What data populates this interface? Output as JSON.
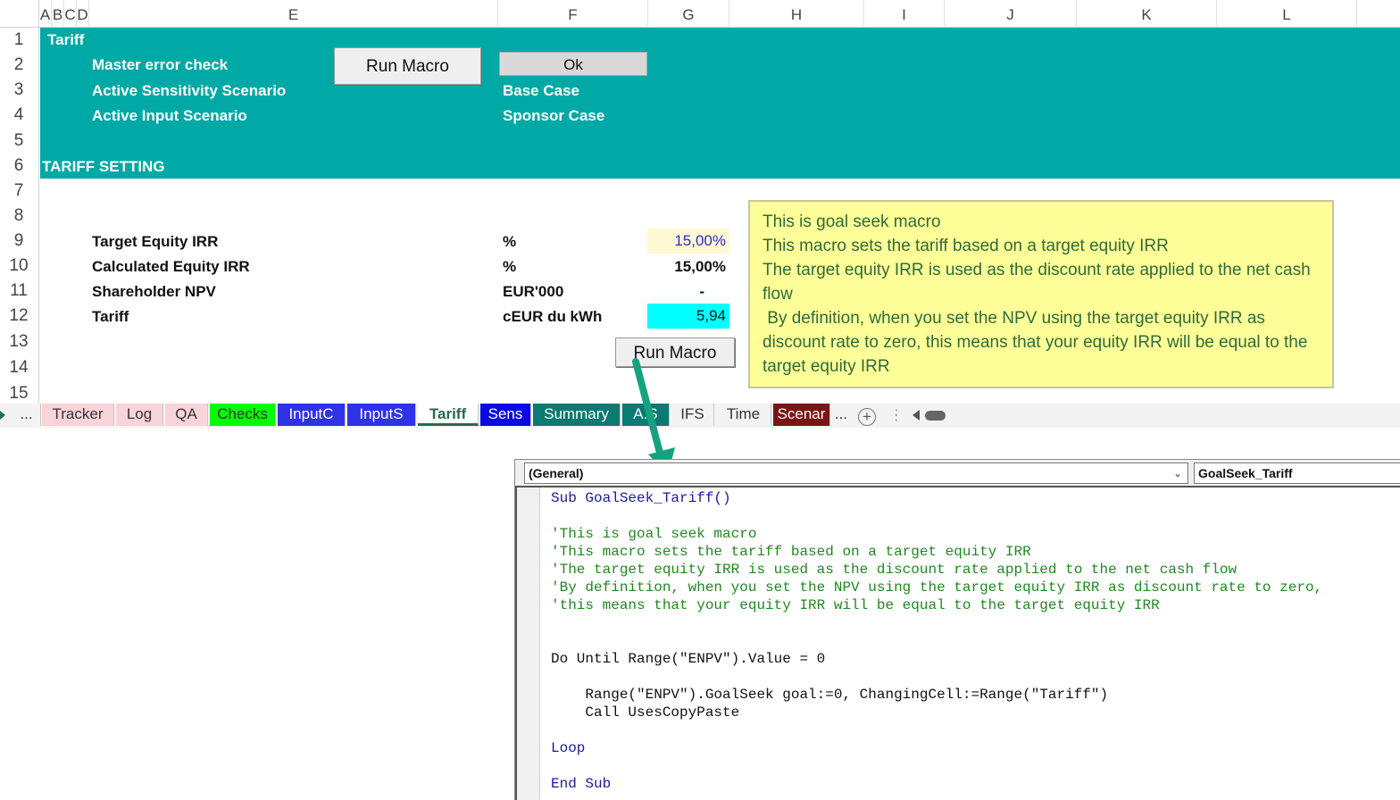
{
  "columns": [
    "A",
    "B",
    "C",
    "D",
    "E",
    "F",
    "G",
    "H",
    "I",
    "J",
    "K",
    "L"
  ],
  "rows": [
    "1",
    "2",
    "3",
    "4",
    "5",
    "6",
    "7",
    "8",
    "9",
    "10",
    "11",
    "12",
    "13",
    "14",
    "15"
  ],
  "sheet": {
    "title": "Tariff",
    "master_error_label": "Master error check",
    "sensitivity_label": "Active Sensitivity Scenario",
    "input_scenario_label": "Active Input Scenario",
    "run_macro_1": "Run Macro",
    "ok_value": "Ok",
    "sensitivity_value": "Base Case",
    "input_scenario_value": "Sponsor Case",
    "section_title": "TARIFF SETTING",
    "target_irr_label": "Target Equity IRR",
    "calc_irr_label": "Calculated Equity IRR",
    "npv_label": "Shareholder NPV",
    "tariff_label": "Tariff",
    "unit_pct_1": "%",
    "unit_pct_2": "%",
    "unit_eur": "EUR'000",
    "unit_tariff": "cEUR du kWh",
    "target_irr_value": "15,00%",
    "calc_irr_value": "15,00%",
    "npv_value": "-",
    "tariff_value": "5,94",
    "run_macro_2": "Run Macro"
  },
  "note": [
    "This is goal seek macro",
    "This macro sets the tariff based on a target equity IRR",
    "The target equity IRR is used as the discount rate applied to the net cash flow",
    " By definition, when you set the NPV using the target equity IRR as discount rate to zero, this means that your equity IRR will be equal to the target equity IRR"
  ],
  "tabs": {
    "more_left": "...",
    "items": [
      "Tracker",
      "Log",
      "QA",
      "Checks",
      "InputC",
      "InputS",
      "Tariff",
      "Sens",
      "Summary",
      "A.S",
      "IFS",
      "Time",
      "Scenar"
    ],
    "more_right": "...",
    "active": "Tariff",
    "colors": {
      "Tracker": "#f8d3d8",
      "Log": "#f8d3d8",
      "QA": "#f8d3d8",
      "Checks": "#00ff00",
      "InputC": "#2f33e8",
      "InputS": "#2f33e8",
      "Sens": "#0a0ae0",
      "Summary": "#0b7a70",
      "A.S": "#0b7a70",
      "Scenar": "#7a1414"
    }
  },
  "vbe": {
    "object_combo": "(General)",
    "proc_combo": "GoalSeek_Tariff",
    "code": [
      "Sub GoalSeek_Tariff()",
      "",
      "'This is goal seek macro",
      "'This macro sets the tariff based on a target equity IRR",
      "'The target equity IRR is used as the discount rate applied to the net cash flow",
      "'By definition, when you set the NPV using the target equity IRR as discount rate to zero,",
      "'this means that your equity IRR will be equal to the target equity IRR",
      "",
      "",
      "Do Until Range(\"ENPV\").Value = 0",
      "",
      "    Range(\"ENPV\").GoalSeek goal:=0, ChangingCell:=Range(\"Tariff\")",
      "    Call UsesCopyPaste",
      "",
      "Loop",
      "",
      "End Sub"
    ]
  },
  "colors": {
    "header_band": "#00a9a5",
    "input_cell": "#fff9d3",
    "tariff_cell": "#00ffff",
    "note_bg": "#ffff99",
    "note_text": "#2f6b3a",
    "arrow": "#14a37f",
    "vba_keyword": "#1b1b9e",
    "vba_comment": "#1f8a1f"
  }
}
